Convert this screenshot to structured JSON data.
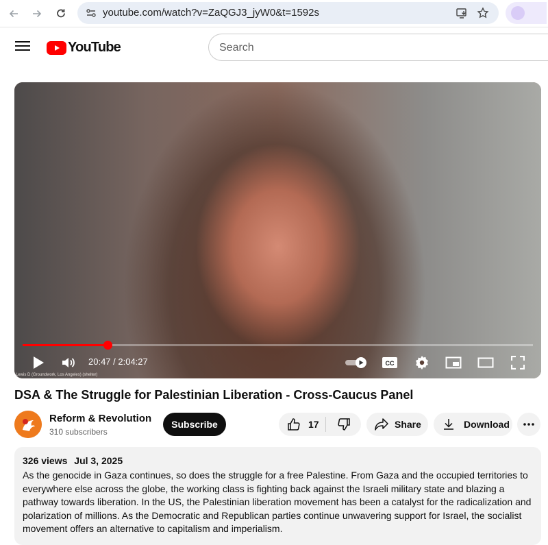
{
  "browser": {
    "url": "youtube.com/watch?v=ZaQGJ3_jyW0&t=1592s",
    "icons": [
      "back-arrow-icon",
      "forward-arrow-icon",
      "reload-icon",
      "site-settings-icon",
      "install-app-icon",
      "bookmark-star-icon"
    ]
  },
  "header": {
    "logo_text": "YouTube",
    "search_placeholder": "Search"
  },
  "player": {
    "current_time": "20:47",
    "duration": "2:04:27",
    "time_display": "20:47 / 2:04:27",
    "progress_fraction": 0.167,
    "video_overlay_text": "Lewis D (Groundwork, Los Angeles) (shelter)",
    "autoplay": "on",
    "colors": {
      "progress": "#ff0000"
    }
  },
  "video": {
    "title": "DSA & The Struggle for Palestinian Liberation - Cross-Caucus Panel"
  },
  "channel": {
    "name": "Reform & Revolution",
    "subscribers": "310 subscribers",
    "subscribe_label": "Subscribe"
  },
  "actions": {
    "like_count": "17",
    "share_label": "Share",
    "download_label": "Download"
  },
  "description": {
    "views": "326 views",
    "date": "Jul 3, 2025",
    "text": "As the genocide in Gaza continues, so does the struggle for a free Palestine. From Gaza and the occupied territories to everywhere else across the globe, the working class is fighting back against the Israeli military state and blazing a pathway towards liberation. In the US, the Palestinian liberation movement has been a catalyst for the radicalization and polarization of millions. As the Democratic and Republican parties continue unwavering support for Israel, the socialist movement offers an alternative to capitalism and imperialism."
  }
}
